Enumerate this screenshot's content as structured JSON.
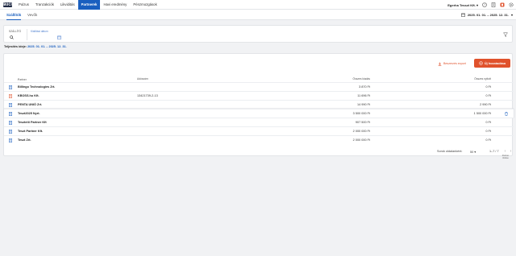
{
  "app": {
    "logo": "BUCI"
  },
  "nav": {
    "items": [
      {
        "label": "Pulzus",
        "active": false
      },
      {
        "label": "Tranzakciók",
        "active": false
      },
      {
        "label": "Likviditás",
        "active": false
      },
      {
        "label": "Partnerek",
        "active": true
      },
      {
        "label": "Havi eredmény",
        "active": false
      },
      {
        "label": "Pénzmozgások",
        "active": false
      }
    ],
    "company": "Egerha Tesszt Kft."
  },
  "subnav": {
    "tabs": [
      {
        "label": "Szállítók",
        "active": true
      },
      {
        "label": "Vevők",
        "active": false
      }
    ],
    "period": "2025. 01. 01. – 2025. 12. 31."
  },
  "filter": {
    "search_label": "SZÁLLÍTÓ",
    "date_placeholder": "Kiállítási dátum"
  },
  "date_range": {
    "label": "Teljesítés ideje:",
    "value": "2025. 01. 01. – 2025. 12. 31."
  },
  "actions": {
    "export": "Beszerzés export",
    "new_partner": "Új hozzáadása"
  },
  "table": {
    "headers": {
      "partner": "Partner",
      "tax_id": "Adószám",
      "total": "Összes kiadás",
      "open": "Összes nyitott"
    },
    "rows": [
      {
        "name": "Billingo Technologies Zrt.",
        "tax": "",
        "total": "3 870 Ft",
        "open": "0 Ft",
        "icon_color": "#1a5fbf"
      },
      {
        "name": "KBOSS.hu Kft.",
        "tax": "13421739-2-13",
        "total": "11 696 Ft",
        "open": "0 Ft",
        "icon_color": "#e0522c"
      },
      {
        "name": "PENTA UNIÓ Zrt.",
        "tax": "",
        "total": "14 990 Ft",
        "open": "2 990 Ft",
        "icon_color": "#1a5fbf"
      },
      {
        "name": "Teszt2025 Nyrt.",
        "tax": "",
        "total": "3 500 000 Ft",
        "open": "1 500 000 Ft",
        "icon_color": "#1a5fbf"
      },
      {
        "name": "Tesztelő Partner Kft",
        "tax": "",
        "total": "907 500 Ft",
        "open": "0 Ft",
        "icon_color": "#1a5fbf"
      },
      {
        "name": "Teszt Partner Kft.",
        "tax": "",
        "total": "2 000 000 Ft",
        "open": "0 Ft",
        "icon_color": "#1a5fbf"
      },
      {
        "name": "Teszt Zrt.",
        "tax": "",
        "total": "2 000 000 Ft",
        "open": "0 Ft",
        "icon_color": "#1a5fbf"
      }
    ],
    "delete_tooltip": "Partner törlése"
  },
  "pager": {
    "rows_per_page_label": "Sorok oldalanként:",
    "rows_per_page": "50",
    "range": "1–7 / 7"
  },
  "colors": {
    "primary": "#1a5fbf",
    "accent": "#e0522c"
  }
}
